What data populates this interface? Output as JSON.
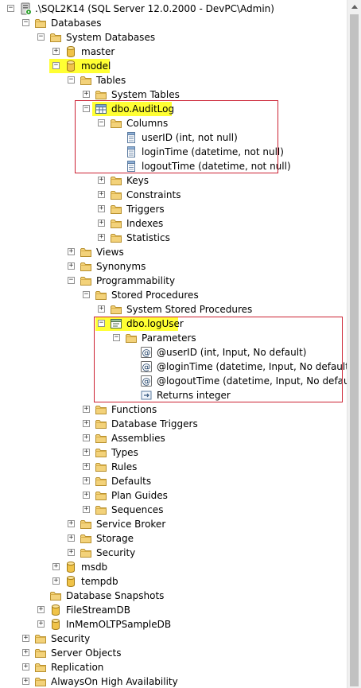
{
  "tree": {
    "server_label": ".\\SQL2K14 (SQL Server 12.0.2000 - DevPC\\Admin)",
    "databases": "Databases",
    "system_databases": "System Databases",
    "master": "master",
    "model": "model",
    "tables": "Tables",
    "system_tables": "System Tables",
    "auditlog": "dbo.AuditLog",
    "columns": "Columns",
    "col_userid": "userID (int, not null)",
    "col_logintime": "loginTime (datetime, not null)",
    "col_logouttime": "logoutTime (datetime, not null)",
    "keys": "Keys",
    "constraints": "Constraints",
    "triggers": "Triggers",
    "indexes": "Indexes",
    "statistics": "Statistics",
    "views": "Views",
    "synonyms": "Synonyms",
    "programmability": "Programmability",
    "stored_procedures": "Stored Procedures",
    "system_stored_procedures": "System Stored Procedures",
    "loguser": "dbo.logUser",
    "parameters": "Parameters",
    "param_userid": "@userID (int, Input, No default)",
    "param_logintime": "@loginTime (datetime, Input, No default)",
    "param_logouttime": "@logoutTime (datetime, Input, No default)",
    "returns": "Returns integer",
    "functions": "Functions",
    "database_triggers": "Database Triggers",
    "assemblies": "Assemblies",
    "types": "Types",
    "rules": "Rules",
    "defaults": "Defaults",
    "plan_guides": "Plan Guides",
    "sequences": "Sequences",
    "service_broker": "Service Broker",
    "storage": "Storage",
    "security_model": "Security",
    "msdb": "msdb",
    "tempdb": "tempdb",
    "database_snapshots": "Database Snapshots",
    "filestreamdb": "FileStreamDB",
    "inmemdb": "InMemOLTPSampleDB",
    "security": "Security",
    "server_objects": "Server Objects",
    "replication": "Replication",
    "alwayson": "AlwaysOn High Availability"
  },
  "colors": {
    "highlight": "#ffff33",
    "annotation_box": "#cc2233",
    "folder": "#e8c25a"
  }
}
